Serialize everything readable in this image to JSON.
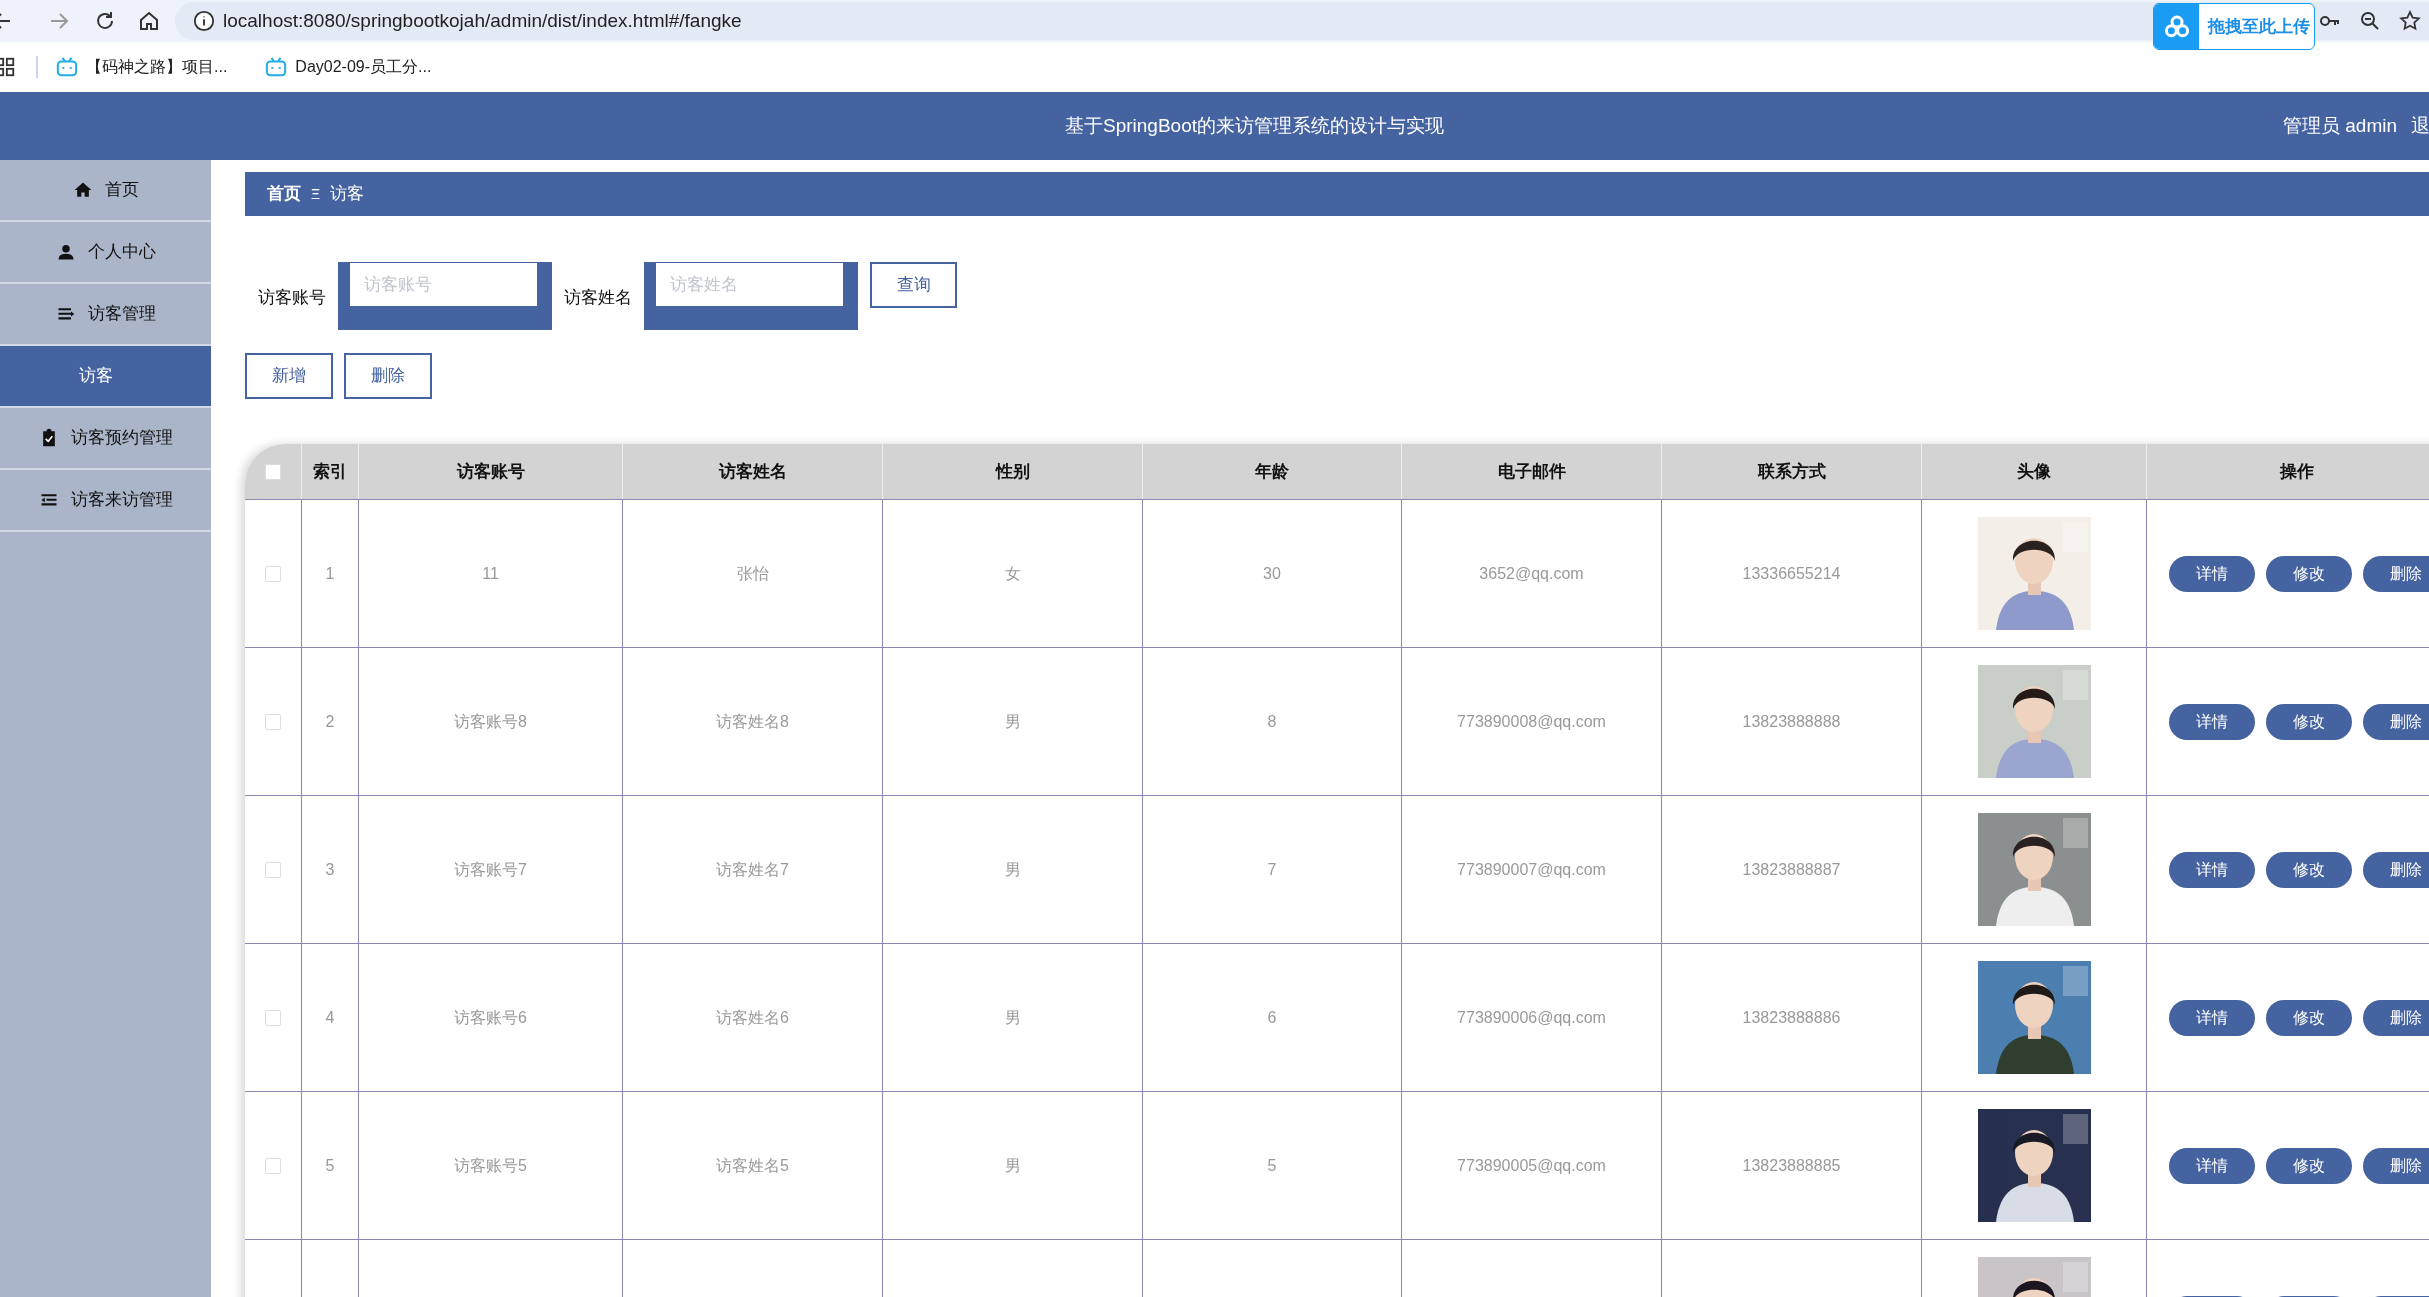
{
  "browser": {
    "url": "localhost:8080/springbootkojah/admin/dist/index.html#/fangke",
    "upload_widget": "拖拽至此上传",
    "bookmarks": [
      {
        "label": "【码神之路】项目..."
      },
      {
        "label": "Day02-09-员工分..."
      }
    ]
  },
  "header": {
    "title": "基于SpringBoot的来访管理系统的设计与实现",
    "user": "管理员 admin",
    "logout": "退"
  },
  "sidebar": {
    "items": [
      {
        "label": "首页",
        "selected": false
      },
      {
        "label": "个人中心",
        "selected": false
      },
      {
        "label": "访客管理",
        "selected": false,
        "children": [
          {
            "label": "访客",
            "selected": true
          }
        ]
      },
      {
        "label": "访客预约管理",
        "selected": false
      },
      {
        "label": "访客来访管理",
        "selected": false
      }
    ]
  },
  "breadcrumb": {
    "home": "首页",
    "separator": "Ξ",
    "current": "访客"
  },
  "search": {
    "fields": [
      {
        "label": "访客账号",
        "placeholder": "访客账号"
      },
      {
        "label": "访客姓名",
        "placeholder": "访客姓名"
      }
    ],
    "button": "查询"
  },
  "actions": [
    "新增",
    "删除"
  ],
  "table": {
    "all_checked": false,
    "columns": [
      "索引",
      "访客账号",
      "访客姓名",
      "性别",
      "年龄",
      "电子邮件",
      "联系方式",
      "头像",
      "操作"
    ],
    "rows": [
      {
        "kind": "full",
        "checked": false,
        "cells": [
          "1",
          "11",
          "张怡",
          "女",
          "30",
          "3652@qq.com",
          "13336655214"
        ],
        "buttons": [
          "详情",
          "修改",
          "删除"
        ]
      },
      {
        "kind": "full",
        "checked": false,
        "cells": [
          "2",
          "访客账号8",
          "访客姓名8",
          "男",
          "8",
          "773890008@qq.com",
          "13823888888"
        ],
        "buttons": [
          "详情",
          "修改",
          "删除"
        ]
      },
      {
        "kind": "full",
        "checked": false,
        "cells": [
          "3",
          "访客账号7",
          "访客姓名7",
          "男",
          "7",
          "773890007@qq.com",
          "13823888887"
        ],
        "buttons": [
          "详情",
          "修改",
          "删除"
        ]
      },
      {
        "kind": "full",
        "checked": false,
        "cells": [
          "4",
          "访客账号6",
          "访客姓名6",
          "男",
          "6",
          "773890006@qq.com",
          "13823888886"
        ],
        "buttons": [
          "详情",
          "修改",
          "删除"
        ]
      },
      {
        "kind": "full",
        "checked": false,
        "cells": [
          "5",
          "访客账号5",
          "访客姓名5",
          "男",
          "5",
          "773890005@qq.com",
          "13823888885"
        ],
        "buttons": [
          "详情",
          "修改",
          "删除"
        ]
      },
      {
        "kind": "partial"
      }
    ]
  }
}
